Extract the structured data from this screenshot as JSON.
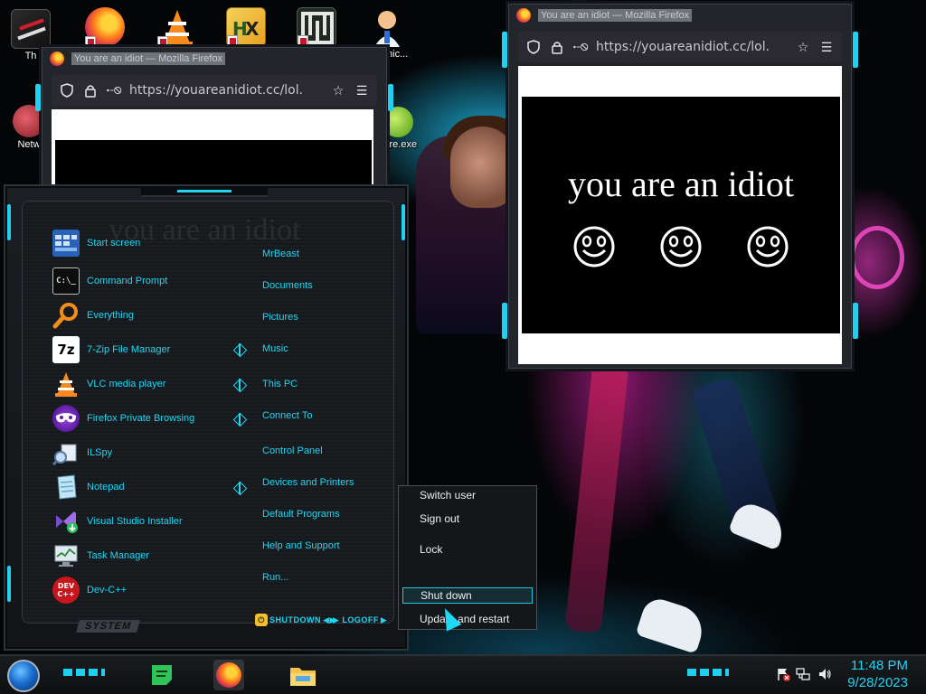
{
  "desktop": {
    "icons": [
      {
        "label": "Th",
        "icon": "app-icon"
      },
      {
        "label": "",
        "icon": "firefox-icon"
      },
      {
        "label": "",
        "icon": "vlc-icon"
      },
      {
        "label": "",
        "icon": "hxd-icon"
      },
      {
        "label": "",
        "icon": "maze-icon"
      },
      {
        "label": "Technic...",
        "icon": "technician-icon"
      },
      {
        "label": "Netw",
        "icon": "network-icon"
      },
      {
        "label": "...ire.exe",
        "icon": "lime-icon"
      }
    ]
  },
  "firefox_window_left": {
    "title": "You are an idiot — Mozilla Firefox",
    "url": "https://youareanidiot.cc/lol."
  },
  "firefox_window_right": {
    "title": "You are an idiot — Mozilla Firefox",
    "url": "https://youareanidiot.cc/lol.",
    "page_text": "you are an idiot"
  },
  "start_menu": {
    "programs": [
      {
        "label": "Start screen",
        "icon": "start-screen-icon"
      },
      {
        "label": "Command Prompt",
        "icon": "command-prompt-icon"
      },
      {
        "label": "Everything",
        "icon": "everything-search-icon"
      },
      {
        "label": "7-Zip File Manager",
        "icon": "7zip-icon"
      },
      {
        "label": "VLC media player",
        "icon": "vlc-icon"
      },
      {
        "label": "Firefox Private Browsing",
        "icon": "firefox-private-icon"
      },
      {
        "label": "ILSpy",
        "icon": "ilspy-icon"
      },
      {
        "label": "Notepad",
        "icon": "notepad-icon"
      },
      {
        "label": "Visual Studio Installer",
        "icon": "visual-studio-installer-icon"
      },
      {
        "label": "Task Manager",
        "icon": "task-manager-icon"
      },
      {
        "label": "Dev-C++",
        "icon": "devcpp-icon"
      }
    ],
    "places": [
      {
        "label": "MrBeast",
        "submenu": false
      },
      {
        "label": "Documents",
        "submenu": false
      },
      {
        "label": "Pictures",
        "submenu": false
      },
      {
        "label": "Music",
        "submenu": true
      },
      {
        "label": "This PC",
        "submenu": true
      },
      {
        "label": "Connect To",
        "submenu": true
      },
      {
        "label": "Control Panel",
        "submenu": false
      },
      {
        "label": "Devices and Printers",
        "submenu": true
      },
      {
        "label": "Default Programs",
        "submenu": false
      },
      {
        "label": "Help and Support",
        "submenu": false
      },
      {
        "label": "Run...",
        "submenu": false
      }
    ],
    "ghost_text": "you are an idiot",
    "system_label": "SYSTEM",
    "shutdown_label": "SHUTDOWN",
    "logoff_label": "LOGOFF"
  },
  "power_submenu": {
    "items": [
      {
        "label": "Switch user"
      },
      {
        "label": "Sign out"
      },
      {
        "label": "Lock"
      },
      {
        "label": "Shut down"
      },
      {
        "label": "Update and restart"
      }
    ],
    "highlighted": "Shut down"
  },
  "taskbar": {
    "apps": [
      {
        "icon": "green-notes-icon"
      },
      {
        "icon": "firefox-icon"
      },
      {
        "icon": "file-explorer-icon"
      }
    ],
    "tray": [
      {
        "icon": "security-flag-icon"
      },
      {
        "icon": "network-icon"
      },
      {
        "icon": "volume-icon"
      }
    ],
    "time": "11:48 PM",
    "date": "9/28/2023"
  },
  "colors": {
    "accent": "#1dd7f5",
    "highlight_border": "#23c6e6"
  }
}
